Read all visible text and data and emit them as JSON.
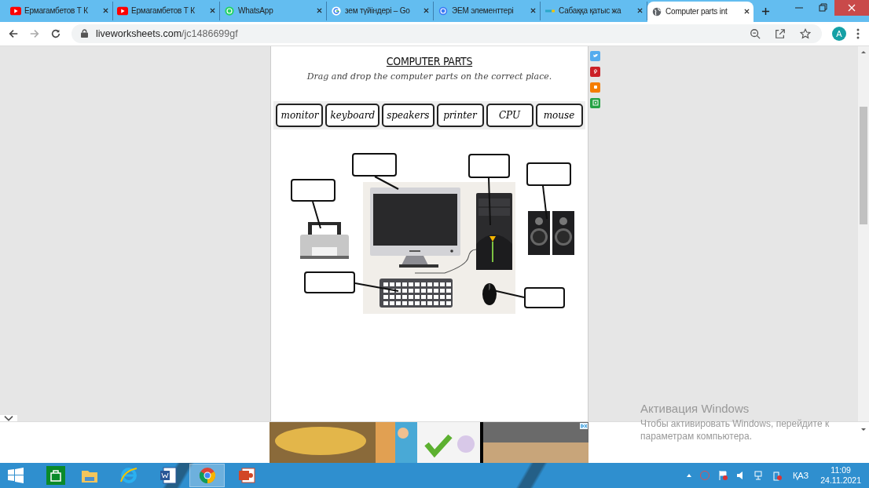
{
  "browser": {
    "tabs": [
      {
        "title": "Ермагамбетов Т К",
        "kind": "youtube",
        "selected": false
      },
      {
        "title": "Ермагамбетов Т К",
        "kind": "youtube",
        "selected": false
      },
      {
        "title": "WhatsApp",
        "kind": "whatsapp",
        "selected": false
      },
      {
        "title": "зем түйіндері – Go",
        "kind": "google",
        "selected": false
      },
      {
        "title": "ЭЕМ элементтері",
        "kind": "circle",
        "selected": false
      },
      {
        "title": "Сабаққа қатыс жа",
        "kind": "site",
        "selected": false
      },
      {
        "title": "Computer parts int",
        "kind": "globe",
        "selected": true
      }
    ],
    "address_host": "liveworksheets.com",
    "address_path": "/jc1486699gf",
    "profile": "A"
  },
  "worksheet": {
    "title": "COMPUTER PARTS",
    "instruction": "Drag and drop the computer parts on the correct place.",
    "words": [
      "monitor",
      "keyboard",
      "speakers",
      "printer",
      "CPU",
      "mouse"
    ]
  },
  "share": [
    {
      "kind": "twitter",
      "color": "#55acee"
    },
    {
      "kind": "pinterest",
      "color": "#cb2027"
    },
    {
      "kind": "blogger",
      "color": "#f57d00"
    },
    {
      "kind": "classroom",
      "color": "#25a244"
    }
  ],
  "activation": {
    "title": "Активация Windows",
    "text": "Чтобы активировать Windows, перейдите к параметрам компьютера."
  },
  "taskbar": {
    "apps": [
      {
        "kind": "store",
        "selected": false
      },
      {
        "kind": "explorer",
        "selected": false
      },
      {
        "kind": "ie",
        "selected": false
      },
      {
        "kind": "word",
        "selected": false
      },
      {
        "kind": "chrome",
        "selected": true
      },
      {
        "kind": "powerpoint",
        "selected": false
      }
    ],
    "language": "ҚАЗ",
    "time": "11:09",
    "date": "24.11.2021"
  }
}
